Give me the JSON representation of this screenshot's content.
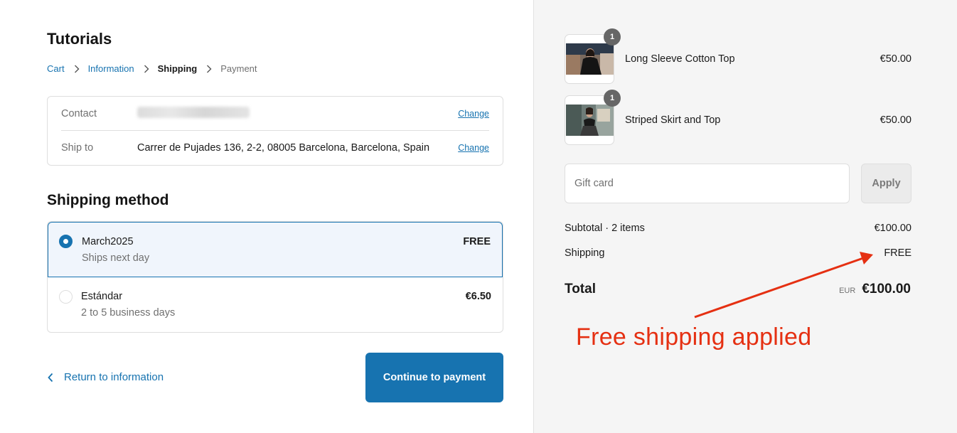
{
  "store": {
    "title": "Tutorials"
  },
  "breadcrumb": {
    "items": [
      {
        "label": "Cart"
      },
      {
        "label": "Information"
      },
      {
        "label": "Shipping"
      },
      {
        "label": "Payment"
      }
    ]
  },
  "review": {
    "contact_label": "Contact",
    "contact_change": "Change",
    "ship_to_label": "Ship to",
    "ship_to_value": "Carrer de Pujades 136, 2-2, 08005 Barcelona, Barcelona, Spain",
    "ship_to_change": "Change"
  },
  "shipping_method": {
    "title": "Shipping method",
    "options": [
      {
        "name": "March2025",
        "detail": "Ships next day",
        "price": "FREE",
        "selected": true
      },
      {
        "name": "Estándar",
        "detail": "2 to 5 business days",
        "price": "€6.50",
        "selected": false
      }
    ]
  },
  "footer": {
    "return_label": "Return to information",
    "continue_label": "Continue to payment"
  },
  "summary": {
    "items": [
      {
        "name": "Long Sleeve Cotton Top",
        "price": "€50.00",
        "qty": "1"
      },
      {
        "name": "Striped Skirt and Top",
        "price": "€50.00",
        "qty": "1"
      }
    ],
    "gift_card_placeholder": "Gift card",
    "apply_label": "Apply",
    "subtotal_label": "Subtotal · 2 items",
    "subtotal_value": "€100.00",
    "shipping_label": "Shipping",
    "shipping_value": "FREE",
    "total_label": "Total",
    "total_currency": "EUR",
    "total_value": "€100.00"
  },
  "annotation": {
    "text": "Free shipping applied"
  },
  "colors": {
    "accent": "#1773b0",
    "annotation": "#e53012",
    "sidebar_bg": "#f5f5f5"
  }
}
